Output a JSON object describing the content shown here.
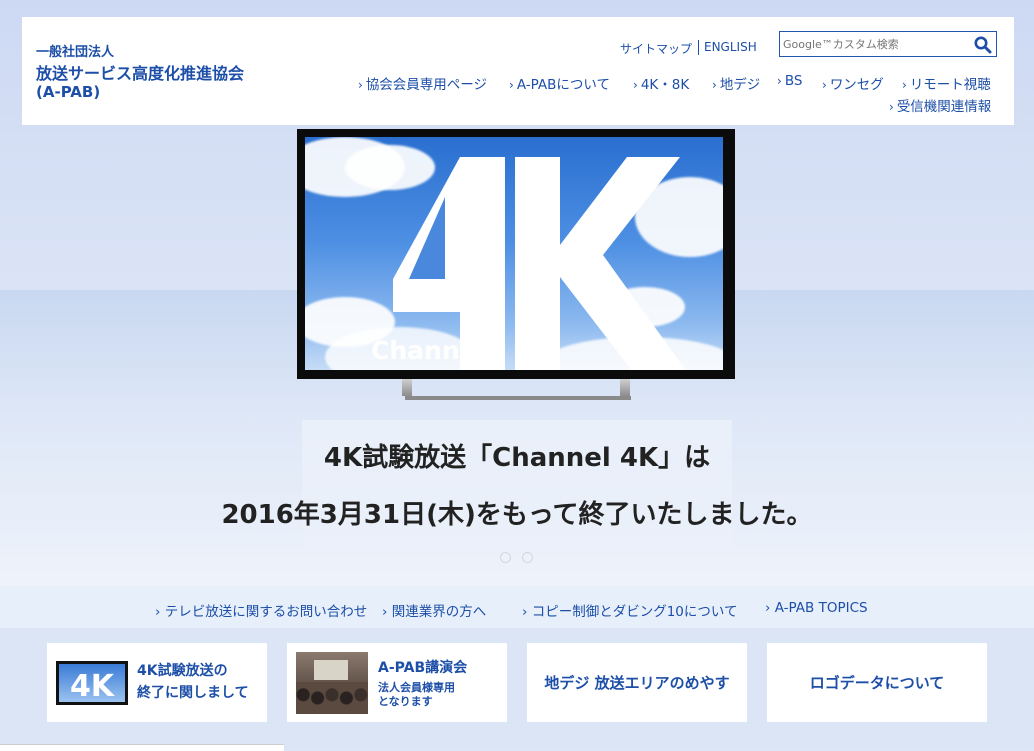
{
  "header": {
    "org_small": "一般社団法人",
    "org_name": "放送サービス高度化推進協会",
    "org_abbr": "(A-PAB)",
    "util_links": {
      "sitemap": "サイトマップ",
      "english": "ENGLISH"
    },
    "search": {
      "placeholder": "Google™カスタム検索",
      "icon": "search-icon"
    },
    "nav_row1": [
      "協会会員専用ページ",
      "A-PABについて",
      "4K・8K",
      "地デジ",
      "BS",
      "ワンセグ",
      "リモート視聴"
    ],
    "nav_row2": [
      "受信機関連情報"
    ]
  },
  "hero": {
    "tv_big_text": "4K",
    "tv_brand": "Channel",
    "line1": "4K試験放送「Channel 4K」は",
    "line2": "2016年3月31日(木)をもって終了いたしました。",
    "slide_count": 2
  },
  "subnav": [
    "テレビ放送に関するお問い合わせ",
    "関連業界の方へ",
    "コピー制御とダビング10について",
    "A-PAB TOPICS"
  ],
  "cards": [
    {
      "line1": "4K試験放送の",
      "line2": "終了に関しまして",
      "thumb_text": "4K"
    },
    {
      "title": "A-PAB講演会",
      "sub1": "法人会員様専用",
      "sub2": "となります"
    },
    {
      "title": "地デジ 放送エリアのめやす"
    },
    {
      "title": "ロゴデータについて"
    }
  ],
  "colors": {
    "link": "#1d4fa8",
    "background": "#dce6f6"
  }
}
